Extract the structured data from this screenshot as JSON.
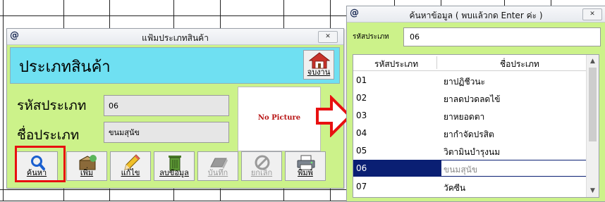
{
  "category_window": {
    "title_icon": "@",
    "title": "แฟ้มประเภทสินค้า",
    "close_label": "✕",
    "header_text": "ประเภทสินค้า",
    "exit_label": "จบงาน",
    "code_label": "รหัสประเภท",
    "code_value": "06",
    "name_label": "ชื่อประเภท",
    "name_value": "ขนมสุนัข",
    "picture_placeholder": "No Picture",
    "toolbar": [
      {
        "label": "ค้นหา",
        "icon": "search-icon",
        "disabled": false
      },
      {
        "label": "เพิ่ม",
        "icon": "add-box-icon",
        "disabled": false
      },
      {
        "label": "แก้ไข",
        "icon": "pencil-icon",
        "disabled": false
      },
      {
        "label": "ลบข้อมูล",
        "icon": "trash-icon",
        "disabled": false
      },
      {
        "label": "บันทึก",
        "icon": "save-icon",
        "disabled": true
      },
      {
        "label": "ยกเลิก",
        "icon": "cancel-icon",
        "disabled": true
      },
      {
        "label": "พิมพ์",
        "icon": "printer-icon",
        "disabled": false
      }
    ]
  },
  "search_window": {
    "title_icon": "@",
    "title": "ค้นหาข้อมูล ( พบแล้วกด Enter ค่ะ )",
    "close_label": "✕",
    "search_label": "รหัสประเภท",
    "search_value": "06",
    "columns": [
      "รหัสประเภท",
      "ชื่อประเภท"
    ],
    "rows": [
      {
        "code": "01",
        "name": "ยาปฏิชีวนะ"
      },
      {
        "code": "02",
        "name": "ยาลดปวดลดไข้"
      },
      {
        "code": "03",
        "name": "ยาหยอดตา"
      },
      {
        "code": "04",
        "name": "ยากำจัดปรสิต"
      },
      {
        "code": "05",
        "name": "วิตามินบำรุงนม"
      },
      {
        "code": "06",
        "name": "ขนมสุนัข"
      },
      {
        "code": "07",
        "name": "วัคซีน"
      }
    ],
    "selected_index": 5
  },
  "colors": {
    "form_bg": "#ccf28a",
    "header_bg": "#6fe0f2",
    "highlight": "#e81010",
    "arrow": "#e81010",
    "selected_row": "#0a1f73"
  }
}
